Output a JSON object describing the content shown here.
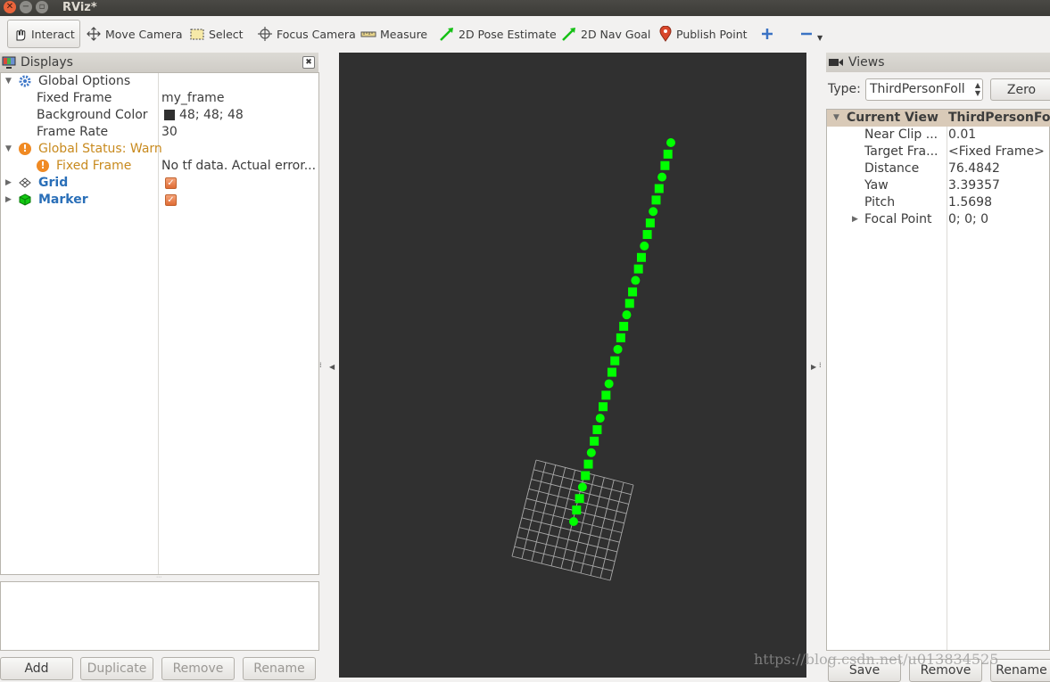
{
  "window": {
    "title": "RViz*"
  },
  "toolbar": {
    "tools": [
      {
        "label": "Interact",
        "icon": "hand-pointer-icon"
      },
      {
        "label": "Move Camera",
        "icon": "move-camera-icon"
      },
      {
        "label": "Select",
        "icon": "select-rect-icon"
      },
      {
        "label": "Focus Camera",
        "icon": "focus-crosshair-icon"
      },
      {
        "label": "Measure",
        "icon": "ruler-icon"
      },
      {
        "label": "2D Pose Estimate",
        "icon": "green-arrow-icon"
      },
      {
        "label": "2D Nav Goal",
        "icon": "green-arrow-icon"
      },
      {
        "label": "Publish Point",
        "icon": "map-pin-icon"
      }
    ],
    "add_icon": "plus-icon",
    "remove_icon": "minus-icon"
  },
  "displays": {
    "title": "Displays",
    "rows": {
      "global_options": "Global Options",
      "fixed_frame_label": "Fixed Frame",
      "fixed_frame_value": "my_frame",
      "bg_color_label": "Background Color",
      "bg_color_value": "48; 48; 48",
      "frame_rate_label": "Frame Rate",
      "frame_rate_value": "30",
      "global_status": "Global Status: Warn",
      "status_fixed_frame": "Fixed Frame",
      "status_fixed_frame_value": "No tf data.  Actual error...",
      "grid": "Grid",
      "marker": "Marker"
    },
    "buttons": {
      "add": "Add",
      "duplicate": "Duplicate",
      "remove": "Remove",
      "rename": "Rename"
    }
  },
  "views": {
    "title": "Views",
    "type_label": "Type:",
    "type_value": "ThirdPersonFoll",
    "zero": "Zero",
    "header_left": "Current View",
    "header_right": "ThirdPersonFoll...",
    "props": [
      {
        "label": "Near Clip ...",
        "value": "0.01"
      },
      {
        "label": "Target Fra...",
        "value": "<Fixed Frame>"
      },
      {
        "label": "Distance",
        "value": "76.4842"
      },
      {
        "label": "Yaw",
        "value": "3.39357"
      },
      {
        "label": "Pitch",
        "value": "1.5698"
      },
      {
        "label": "Focal Point",
        "value": "0; 0; 0"
      }
    ],
    "buttons": {
      "save": "Save",
      "remove": "Remove",
      "rename": "Rename"
    }
  },
  "colors": {
    "viewport_bg": "#303030",
    "marker_green": "#00ff00",
    "warn": "#c88a1e",
    "link_blue": "#2a6fb8"
  },
  "watermark": "https://blog.csdn.net/u013834525"
}
